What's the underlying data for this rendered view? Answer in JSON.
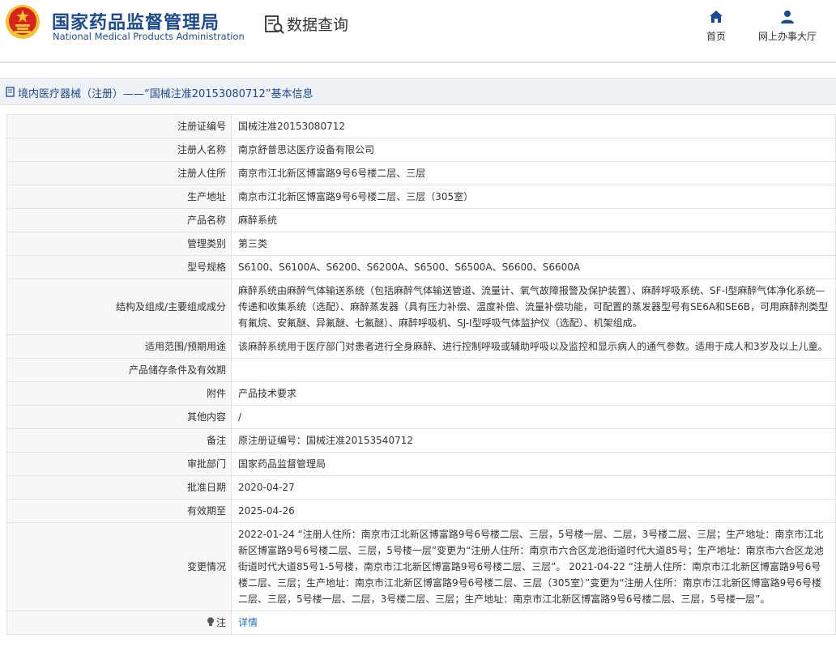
{
  "header": {
    "brand_cn": "国家药品监督管理局",
    "brand_en": "National Medical Products Administration",
    "section_title": "数据查询",
    "nav": {
      "home": "首页",
      "office": "网上办事大厅"
    },
    "colors": {
      "brand": "#1c4a8f",
      "emblem_red": "#d8241c",
      "emblem_gold": "#f2c231"
    }
  },
  "breadcrumb": {
    "text": "境内医疗器械（注册）——“国械注准20153080712”基本信息"
  },
  "rows": [
    {
      "label": "注册证编号",
      "value": "国械注准20153080712"
    },
    {
      "label": "注册人名称",
      "value": "南京舒普思达医疗设备有限公司"
    },
    {
      "label": "注册人住所",
      "value": "南京市江北新区博富路9号6号楼二层、三层"
    },
    {
      "label": "生产地址",
      "value": "南京市江北新区博富路9号6号楼二层、三层（305室）"
    },
    {
      "label": "产品名称",
      "value": "麻醉系统"
    },
    {
      "label": "管理类别",
      "value": "第三类"
    },
    {
      "label": "型号规格",
      "value": "S6100、S6100A、S6200、S6200A、S6500、S6500A、S6600、S6600A"
    },
    {
      "label": "结构及组成/主要组成成分",
      "value": "麻醉系统由麻醉气体输送系统（包括麻醉气体输送管道、流量计、氧气故障报警及保护装置）、麻醉呼吸系统、SF-I型麻醉气体净化系统—传递和收集系统（选配）、麻醉蒸发器（具有压力补偿、温度补偿、流量补偿功能，可配置的蒸发器型号有SE6A和SE6B，可用麻醉剂类型有氟烷、安氟醚、异氟醚、七氟醚）、麻醉呼吸机、SJ-I型呼吸气体监护仪（选配）、机架组成。"
    },
    {
      "label": "适用范围/预期用途",
      "value": "该麻醉系统用于医疗部门对患者进行全身麻醉、进行控制呼吸或辅助呼吸以及监控和显示病人的通气参数。适用于成人和3岁及以上儿童。"
    },
    {
      "label": "产品储存条件及有效期",
      "value": ""
    },
    {
      "label": "附件",
      "value": "产品技术要求"
    },
    {
      "label": "其他内容",
      "value": "/"
    },
    {
      "label": "备注",
      "value": "原注册证编号：国械注准20153540712"
    },
    {
      "label": "审批部门",
      "value": "国家药品监督管理局"
    },
    {
      "label": "批准日期",
      "value": "2020-04-27"
    },
    {
      "label": "有效期至",
      "value": "2025-04-26"
    },
    {
      "label": "变更情况",
      "value": "2022-01-24 “注册人住所：南京市江北新区博富路9号6号楼二层、三层，5号楼一层、二层，3号楼二层、三层；生产地址：南京市江北新区博富路9号6号楼二层、三层，5号楼一层”变更为“注册人住所：南京市六合区龙池街道时代大道85号；生产地址：南京市六合区龙池街道时代大道85号1-5号楼，南京市江北新区博富路9号6号楼二层、三层”。 2021-04-22 “注册人住所：南京市江北新区博富路9号6号楼二层、三层；生产地址：南京市江北新区博富路9号6号楼二层、三层（305室）”变更为“注册人住所：南京市江北新区博富路9号6号楼二层、三层，5号楼一层、二层，3号楼二层、三层；生产地址：南京市江北新区博富路9号6号楼二层、三层，5号楼一层”。"
    }
  ],
  "note_row": {
    "label": "注",
    "link": "详情",
    "icon": "lightbulb-icon"
  }
}
